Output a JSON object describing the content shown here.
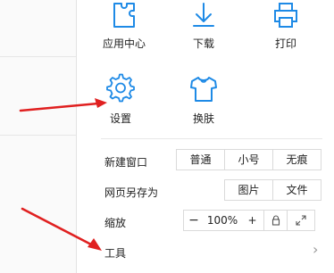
{
  "grid": [
    {
      "label": "应用中心",
      "icon": "puzzle-icon"
    },
    {
      "label": "下载",
      "icon": "download-icon"
    },
    {
      "label": "打印",
      "icon": "printer-icon"
    },
    {
      "label": "设置",
      "icon": "gear-icon"
    },
    {
      "label": "换肤",
      "icon": "tshirt-icon"
    }
  ],
  "new_window": {
    "label": "新建窗口",
    "options": [
      "普通",
      "小号",
      "无痕"
    ]
  },
  "save_as": {
    "label": "网页另存为",
    "options": [
      "图片",
      "文件"
    ]
  },
  "zoom": {
    "label": "缩放",
    "minus": "−",
    "value": "100%",
    "plus": "+"
  },
  "tools": {
    "label": "工具",
    "chevron": "›"
  },
  "colors": {
    "accent": "#1e8ae6",
    "annotation_arrow": "#e02020"
  }
}
